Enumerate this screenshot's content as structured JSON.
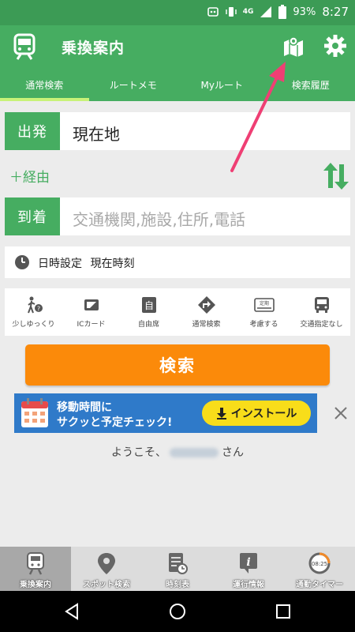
{
  "status_bar": {
    "network": "4G",
    "battery": "93%",
    "time": "8:27"
  },
  "app": {
    "title": "乗換案内"
  },
  "tabs": [
    {
      "label": "通常検索",
      "active": true
    },
    {
      "label": "ルートメモ",
      "active": false
    },
    {
      "label": "Myルート",
      "active": false
    },
    {
      "label": "検索履歴",
      "active": false
    }
  ],
  "departure": {
    "label": "出発",
    "value": "現在地"
  },
  "via": {
    "label": "＋経由"
  },
  "arrival": {
    "label": "到着",
    "placeholder": "交通機関,施設,住所,電話"
  },
  "datetime": {
    "label": "日時設定",
    "value": "現在時刻"
  },
  "options": [
    {
      "icon": "walking-slow-icon",
      "label": "少しゆっくり"
    },
    {
      "icon": "ic-card-icon",
      "label": "ICカード"
    },
    {
      "icon": "reserved-seat-icon",
      "label": "自由席"
    },
    {
      "icon": "route-type-icon",
      "label": "通常検索"
    },
    {
      "icon": "commuter-pass-icon",
      "label": "考慮する"
    },
    {
      "icon": "transport-bus-icon",
      "label": "交通指定なし"
    }
  ],
  "option_badges": {
    "seat": "自",
    "pass": "定期"
  },
  "search_button": {
    "label": "検索"
  },
  "ad": {
    "line1": "移動時間に",
    "line2": "サクッと予定チェック!",
    "install_label": "インストール"
  },
  "welcome": {
    "prefix": "ようこそ、",
    "suffix": "さん"
  },
  "bottom_nav": [
    {
      "icon": "train-icon",
      "label": "乗換案内",
      "active": true
    },
    {
      "icon": "map-pin-icon",
      "label": "スポット検索",
      "active": false
    },
    {
      "icon": "timetable-icon",
      "label": "時刻表",
      "active": false
    },
    {
      "icon": "info-icon",
      "label": "運行情報",
      "active": false
    },
    {
      "icon": "timer-icon",
      "label": "通勤タイマー",
      "active": false
    }
  ],
  "timer_readout": "08:25",
  "colors": {
    "primary_green": "#46ad61",
    "accent_orange": "#fb8a0a",
    "ad_blue": "#2f7ac9",
    "annotation_pink": "#ef3f74"
  }
}
